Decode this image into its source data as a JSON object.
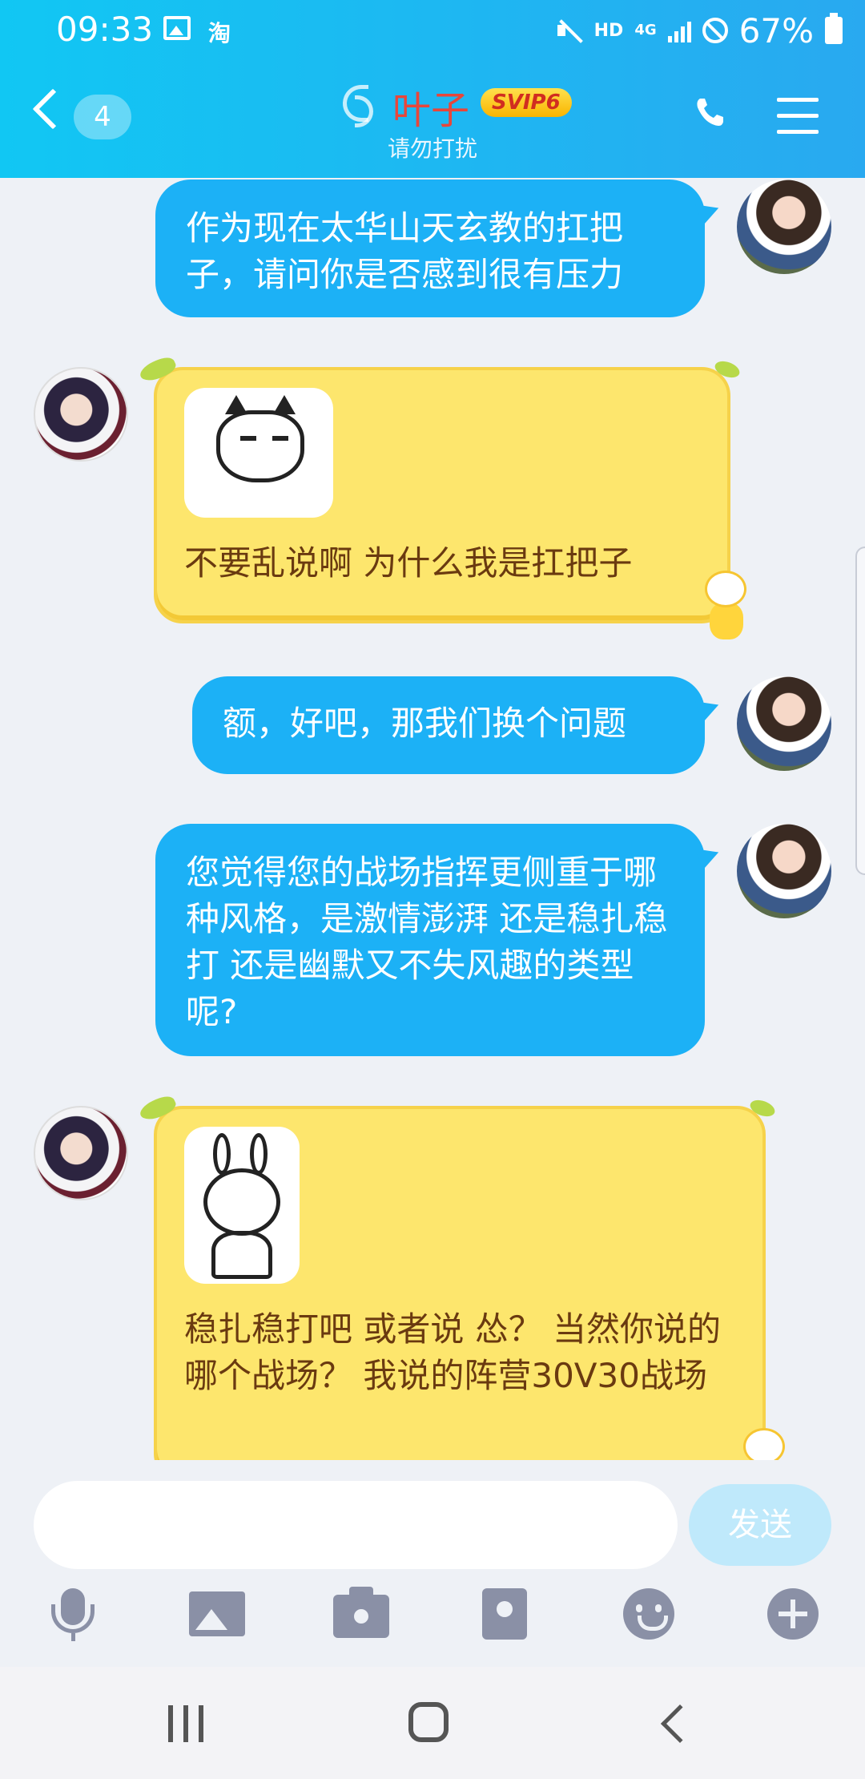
{
  "status_bar": {
    "time": "09:33",
    "app_indicator": "淘",
    "hd_label": "HD",
    "network": "4G",
    "battery": "67%"
  },
  "header": {
    "unread_count": "4",
    "contact_name": "叶子",
    "vip_badge": "SVIP6",
    "contact_status": "请勿打扰",
    "icons": [
      "back-icon",
      "ear-icon",
      "phone-icon",
      "menu-icon"
    ]
  },
  "messages": [
    {
      "sender": "me",
      "text": "作为现在太华山天玄教的扛把子，请问你是否感到很有压力"
    },
    {
      "sender": "other",
      "sticker": "cat-sticker",
      "text": "不要乱说啊  为什么我是扛把子"
    },
    {
      "sender": "me",
      "text": "额，好吧，那我们换个问题"
    },
    {
      "sender": "me",
      "text": "您觉得您的战场指挥更侧重于哪种风格，是激情澎湃 还是稳扎稳打 还是幽默又不失风趣的类型呢?"
    },
    {
      "sender": "other",
      "sticker": "rabbit-sticker",
      "text": "稳扎稳打吧   或者说 怂？   当然你说的哪个战场？   我说的阵营30V30战场"
    }
  ],
  "composer": {
    "input_value": "",
    "send_label": "发送",
    "tools": [
      "mic-icon",
      "image-icon",
      "camera-icon",
      "red-packet-icon",
      "emoji-icon",
      "plus-icon"
    ]
  },
  "colors": {
    "header_start": "#11c7f3",
    "header_end": "#29a9f0",
    "my_bubble": "#1cb1f6",
    "other_bubble": "#fde66d",
    "other_text": "#6a3a10",
    "name_color": "#e8463a"
  }
}
